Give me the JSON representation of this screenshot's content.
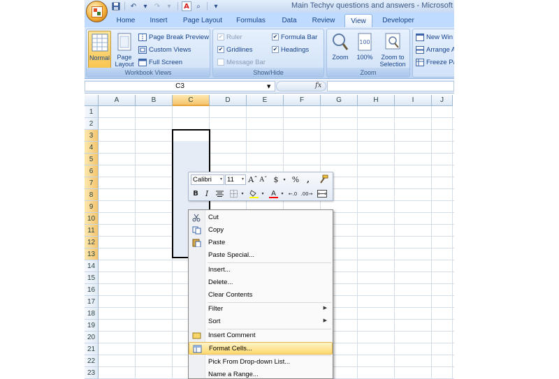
{
  "window": {
    "title": "Main Techyv questions and answers - Microsoft"
  },
  "quick_access": {
    "items": [
      {
        "name": "save-icon",
        "glyph": "▣"
      },
      {
        "name": "undo-icon",
        "glyph": "↶"
      },
      {
        "name": "undo-dropdown-icon",
        "glyph": "▾"
      },
      {
        "name": "redo-icon",
        "glyph": "↷"
      },
      {
        "name": "redo-dropdown-icon",
        "glyph": "▾"
      },
      {
        "name": "font-color-icon",
        "glyph": "A"
      },
      {
        "name": "print-preview-icon",
        "glyph": "⌕"
      },
      {
        "name": "customize-icon",
        "glyph": "▾"
      }
    ]
  },
  "tabs": [
    "Home",
    "Insert",
    "Page Layout",
    "Formulas",
    "Data",
    "Review",
    "View",
    "Developer"
  ],
  "active_tab": "View",
  "ribbon": {
    "workbook_views": {
      "title": "Workbook Views",
      "normal": "Normal",
      "page_layout_1": "Page",
      "page_layout_2": "Layout",
      "page_break_preview": "Page Break Preview",
      "custom_views": "Custom Views",
      "full_screen": "Full Screen"
    },
    "show_hide": {
      "title": "Show/Hide",
      "ruler": "Ruler",
      "gridlines": "Gridlines",
      "message_bar": "Message Bar",
      "formula_bar": "Formula Bar",
      "headings": "Headings",
      "check_glyph": "✔"
    },
    "zoom": {
      "title": "Zoom",
      "zoom": "Zoom",
      "hundred": "100%",
      "zoom_to_1": "Zoom to",
      "zoom_to_2": "Selection"
    },
    "window": {
      "new_window": "New Win",
      "arrange_all": "Arrange A",
      "freeze_panes": "Freeze Pa"
    }
  },
  "formula_bar": {
    "name_box": "C3",
    "dropdown_glyph": "▼",
    "fx": "fx"
  },
  "grid": {
    "columns": [
      "A",
      "B",
      "C",
      "D",
      "E",
      "F",
      "G",
      "H",
      "I",
      "J"
    ],
    "rows": [
      "1",
      "2",
      "3",
      "4",
      "5",
      "6",
      "7",
      "8",
      "9",
      "10",
      "11",
      "12",
      "13",
      "14",
      "15",
      "16",
      "17",
      "18",
      "19",
      "20",
      "21",
      "22",
      "23"
    ],
    "selected_column": "C",
    "selected_rows": [
      "3",
      "4",
      "5",
      "6",
      "7",
      "8",
      "9",
      "10",
      "11",
      "12",
      "13"
    ]
  },
  "mini_toolbar": {
    "font": "Calibri",
    "size": "11",
    "dropdown_glyph": "▾",
    "grow_font": "Aˆ",
    "shrink_font": "Aˇ",
    "currency": "$",
    "percent": "%",
    "comma": ",",
    "bold": "B",
    "italic": "I",
    "increase_decimal": "←.0",
    "decrease_decimal": ".00→"
  },
  "context_menu": {
    "items": [
      {
        "label": "Cut",
        "name": "cut"
      },
      {
        "label": "Copy",
        "name": "copy"
      },
      {
        "label": "Paste",
        "name": "paste"
      },
      {
        "label": "Paste Special...",
        "name": "paste-special"
      },
      {
        "label": "Insert...",
        "name": "insert"
      },
      {
        "label": "Delete...",
        "name": "delete"
      },
      {
        "label": "Clear Contents",
        "name": "clear-contents"
      },
      {
        "label": "Filter",
        "name": "filter",
        "submenu": true
      },
      {
        "label": "Sort",
        "name": "sort",
        "submenu": true
      },
      {
        "label": "Insert Comment",
        "name": "insert-comment"
      },
      {
        "label": "Format Cells...",
        "name": "format-cells",
        "highlighted": true
      },
      {
        "label": "Pick From Drop-down List...",
        "name": "pick-from-list"
      },
      {
        "label": "Name a Range...",
        "name": "name-a-range"
      }
    ],
    "submenu_glyph": "▶"
  },
  "colors": {
    "ribbon_blue": "#bfdbff",
    "selection_orange": "#f5c46c",
    "menu_highlight": "#fdd86e",
    "font_color_red": "#ff0000",
    "highlight_yellow": "#ffff00"
  }
}
